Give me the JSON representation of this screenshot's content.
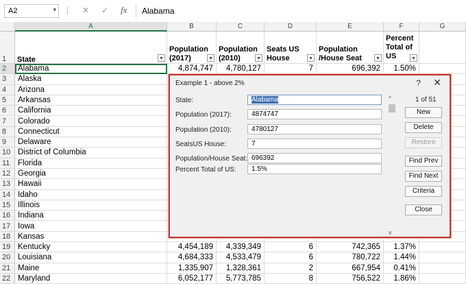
{
  "formula_bar": {
    "name_box": "A2",
    "cancel_glyph": "✕",
    "enter_glyph": "✓",
    "fx_label": "fx",
    "value": "Alabama"
  },
  "columns": [
    "A",
    "B",
    "C",
    "D",
    "E",
    "F",
    "G"
  ],
  "header_row": {
    "row_number": "1",
    "cells": [
      "State",
      "Population (2017)",
      "Population (2010)",
      "Seats US House",
      "Population /House Seat",
      "Percent Total of US",
      ""
    ]
  },
  "rows": [
    {
      "n": "2",
      "state": "Alabama",
      "pop2017": "4,874,747",
      "pop2010": "4,780,127",
      "seats": "7",
      "per_seat": "696,392",
      "pct": "1.50%"
    },
    {
      "n": "3",
      "state": "Alaska"
    },
    {
      "n": "4",
      "state": "Arizona"
    },
    {
      "n": "5",
      "state": "Arkansas"
    },
    {
      "n": "6",
      "state": "California"
    },
    {
      "n": "7",
      "state": "Colorado"
    },
    {
      "n": "8",
      "state": "Connecticut"
    },
    {
      "n": "9",
      "state": "Delaware"
    },
    {
      "n": "10",
      "state": "District of Columbia"
    },
    {
      "n": "11",
      "state": "Florida"
    },
    {
      "n": "12",
      "state": "Georgia"
    },
    {
      "n": "13",
      "state": "Hawaii"
    },
    {
      "n": "14",
      "state": "Idaho"
    },
    {
      "n": "15",
      "state": "Illinois"
    },
    {
      "n": "16",
      "state": "Indiana"
    },
    {
      "n": "17",
      "state": "Iowa"
    },
    {
      "n": "18",
      "state": "Kansas"
    },
    {
      "n": "19",
      "state": "Kentucky",
      "pop2017": "4,454,189",
      "pop2010": "4,339,349",
      "seats": "6",
      "per_seat": "742,365",
      "pct": "1.37%"
    },
    {
      "n": "20",
      "state": "Louisiana",
      "pop2017": "4,684,333",
      "pop2010": "4,533,479",
      "seats": "6",
      "per_seat": "780,722",
      "pct": "1.44%"
    },
    {
      "n": "21",
      "state": "Maine",
      "pop2017": "1,335,907",
      "pop2010": "1,328,361",
      "seats": "2",
      "per_seat": "667,954",
      "pct": "0.41%"
    },
    {
      "n": "22",
      "state": "Maryland",
      "pop2017": "6,052,177",
      "pop2010": "5,773,785",
      "seats": "8",
      "per_seat": "756,522",
      "pct": "1.86%"
    }
  ],
  "dialog": {
    "title": "Example 1 - above 2%",
    "help": "?",
    "close_glyph": "✕",
    "record_counter": "1 of 51",
    "fields": [
      {
        "label": "State:",
        "value": "Alabama"
      },
      {
        "label": "Population (2017):",
        "value": "4874747"
      },
      {
        "label": "Population (2010):",
        "value": "4780127"
      },
      {
        "label": "SeatsUS House:",
        "value": "7"
      },
      {
        "label": "Population/House Seat:",
        "value": "696392"
      },
      {
        "label": "Percent Total of US:",
        "value": "1.5%"
      }
    ],
    "buttons": {
      "new": "New",
      "delete": "Delete",
      "restore": "Restore",
      "find_prev": "Find Prev",
      "find_next": "Find Next",
      "criteria": "Criteria",
      "close": "Close"
    },
    "scroll_up": "^",
    "scroll_down": "v"
  },
  "colors": {
    "accent": "#217346",
    "dialog_border": "#c0392b"
  }
}
